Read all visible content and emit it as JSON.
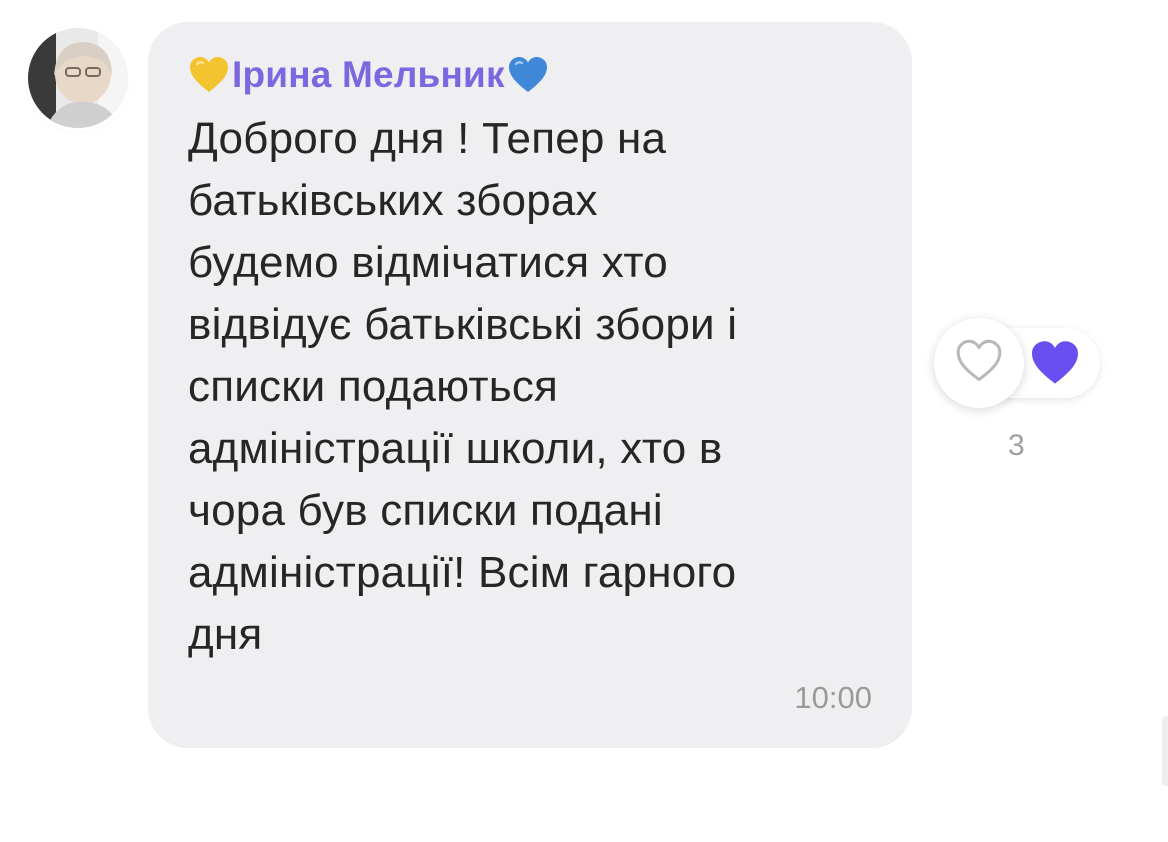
{
  "message": {
    "sender_name": "Ірина Мельник",
    "sender_prefix_icon": "yellow-heart-icon",
    "sender_suffix_icon": "blue-heart-icon",
    "text": "Доброго дня ! Тепер на\nбатьківських зборах\nбудемо відмічатися хто\nвідвідує батьківські збори і\nсписки подаються\nадміністрації школи, хто в\nчора був списки подані\nадміністрації! Всім гарного\nдня",
    "time": "10:00"
  },
  "reactions": {
    "add_icon": "heart-outline-icon",
    "reaction_icon": "purple-heart-icon",
    "count": "3"
  },
  "colors": {
    "sender_name": "#7b68e0",
    "bubble_background": "#efeff1",
    "reaction_heart": "#6a4ff0",
    "yellow_heart": "#f4c430",
    "blue_heart": "#3f88d8"
  }
}
